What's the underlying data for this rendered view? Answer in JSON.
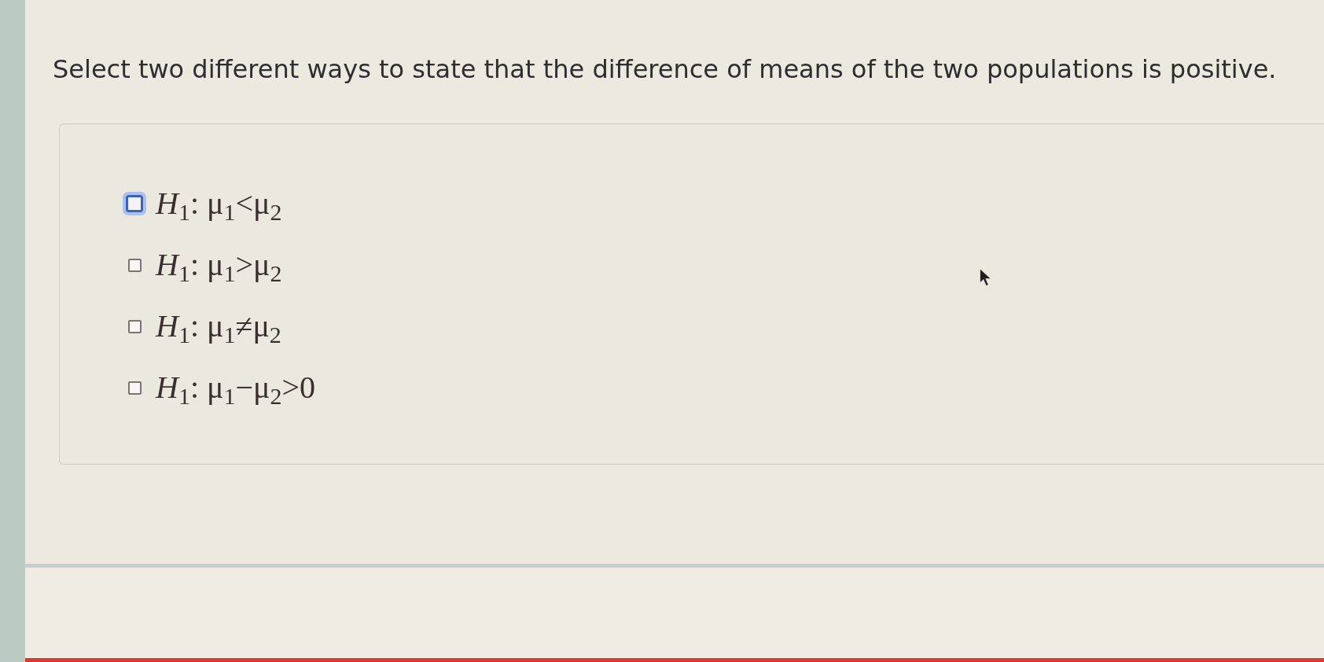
{
  "question": {
    "text": "Select two different ways to state that the difference of means of the two populations is positive."
  },
  "options": [
    {
      "label": "*H*$_{1}$: μ$_{1}$<μ$_{2}$",
      "checked": false,
      "focused": true
    },
    {
      "label": "*H*$_{1}$: μ$_{1}$>μ$_{2}$",
      "checked": false,
      "focused": false
    },
    {
      "label": "*H*$_{1}$: μ$_{1}$≠μ$_{2}$",
      "checked": false,
      "focused": false
    },
    {
      "label": "*H*$_{1}$: μ$_{1}$−μ$_{2}$>0",
      "checked": false,
      "focused": false
    }
  ]
}
